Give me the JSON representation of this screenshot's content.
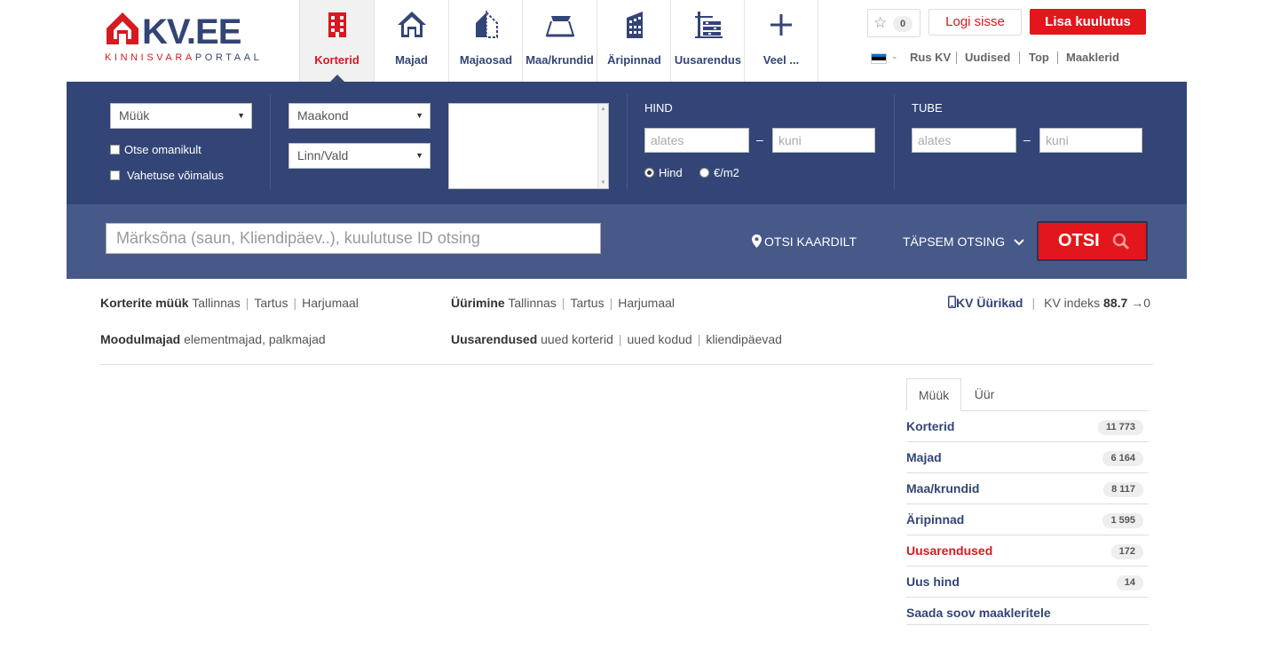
{
  "brand": {
    "name": "KV.EE",
    "tagline_red": "KINNISVARA",
    "tagline_blue": "PORTAAL",
    "red": "#d71920",
    "blue": "#334576"
  },
  "nav": [
    {
      "label": "Korterid",
      "icon": "apartment-icon",
      "active": true
    },
    {
      "label": "Majad",
      "icon": "house-icon"
    },
    {
      "label": "Majaosad",
      "icon": "house-part-icon"
    },
    {
      "label": "Maa/krundid",
      "icon": "land-icon"
    },
    {
      "label": "Äripinnad",
      "icon": "office-building-icon"
    },
    {
      "label": "Uusarendus",
      "icon": "new-development-icon"
    },
    {
      "label": "Veel ...",
      "icon": "plus-icon"
    }
  ],
  "header": {
    "favorites_count": "0",
    "login": "Logi sisse",
    "add_listing": "Lisa kuulutus",
    "links": [
      "Rus KV",
      "Uudised",
      "Top",
      "Maaklerid"
    ]
  },
  "search": {
    "deal_type": "Müük",
    "county": "Maakond",
    "city": "Linn/Vald",
    "owner_direct": "Otse omanikult",
    "exchange_possible": "Vahetuse võimalus",
    "price_heading": "HIND",
    "price_from": "alates",
    "price_to": "kuni",
    "price_mode_total": "Hind",
    "price_mode_m2": "€/m2",
    "rooms_heading": "TUBE",
    "rooms_from": "alates",
    "rooms_to": "kuni",
    "keyword_placeholder": "Märksõna (saun, Kliendipäev..), kuulutuse ID otsing",
    "map_search": "OTSI KAARDILT",
    "advanced": "TÄPSEM OTSING",
    "submit": "OTSI"
  },
  "quick_links": {
    "sale_label": "Korterite müük",
    "sale_items": [
      "Tallinnas",
      "Tartus",
      "Harjumaal"
    ],
    "rent_label": "Üürimine",
    "rent_items": [
      "Tallinnas",
      "Tartus",
      "Harjumaal"
    ],
    "modular_label": "Moodulmajad",
    "modular_items": "elementmajad, palkmajad",
    "newdev_label": "Uusarendused",
    "newdev_items": [
      "uued korterid",
      "uued kodud",
      "kliendipäevad"
    ],
    "renters": "KV Üürikad",
    "index_label": "KV indeks",
    "index_value": "88.7",
    "index_change": "0"
  },
  "stats": {
    "tabs": [
      "Müük",
      "Üür"
    ],
    "rows": [
      {
        "name": "Korterid",
        "count": "11 773"
      },
      {
        "name": "Majad",
        "count": "6 164"
      },
      {
        "name": "Maa/krundid",
        "count": "8 117"
      },
      {
        "name": "Äripinnad",
        "count": "1 595"
      },
      {
        "name": "Uusarendused",
        "count": "172",
        "highlight": true
      },
      {
        "name": "Uus hind",
        "count": "14"
      },
      {
        "name": "Saada soov maakleritele",
        "count": null
      }
    ]
  }
}
